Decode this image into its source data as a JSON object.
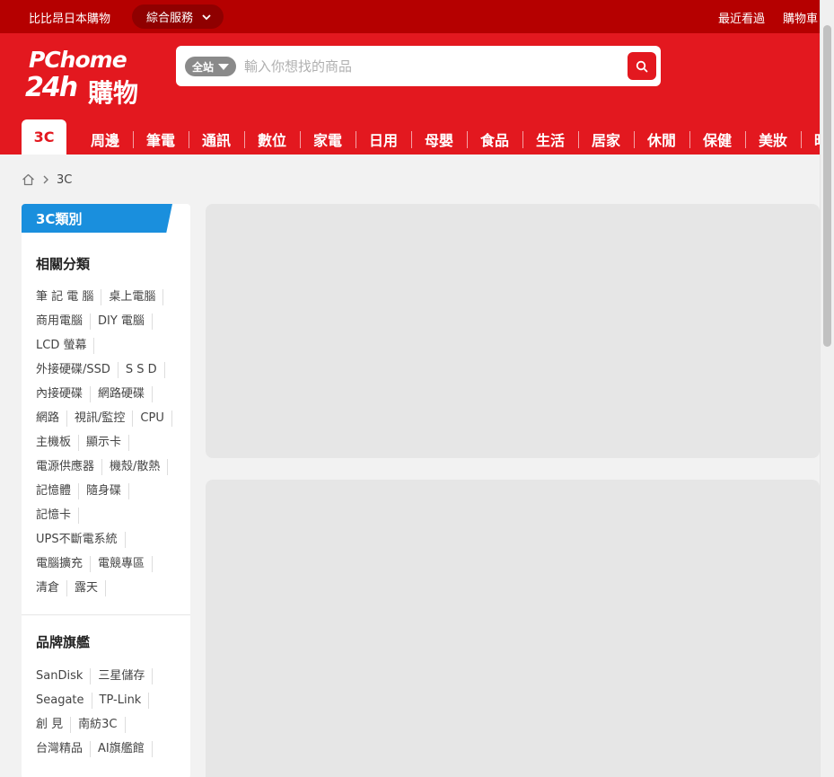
{
  "topbar": {
    "left_link": "比比昂日本購物",
    "service_label": "綜合服務",
    "recent": "最近看過",
    "cart": "購物車"
  },
  "logo": {
    "line1": "PChome",
    "line2": "24h",
    "line3": "購物"
  },
  "search": {
    "scope_label": "全站",
    "placeholder": "輸入你想找的商品"
  },
  "nav": {
    "tabs": [
      "3C",
      "周邊",
      "筆電",
      "通訊",
      "數位",
      "家電",
      "日用",
      "母嬰",
      "食品",
      "生活",
      "居家",
      "休閒",
      "保健",
      "美妝",
      "時尚"
    ]
  },
  "breadcrumb": {
    "current": "3C"
  },
  "sidebar": {
    "tag": "3C類別",
    "related_title": "相關分類",
    "related_rows": [
      [
        "筆 記 電 腦",
        "桌上電腦"
      ],
      [
        "商用電腦",
        "DIY 電腦"
      ],
      [
        "LCD 螢幕"
      ],
      [
        "外接硬碟/SSD",
        "S S D"
      ],
      [
        "內接硬碟",
        "網路硬碟"
      ],
      [
        "網路",
        "視訊/監控",
        "CPU"
      ],
      [
        "主機板",
        "顯示卡"
      ],
      [
        "電源供應器",
        "機殼/散熱"
      ],
      [
        "記憶體",
        "隨身碟"
      ],
      [
        "記憶卡"
      ],
      [
        "UPS不斷電系統"
      ],
      [
        "電腦擴充",
        "電競專區"
      ],
      [
        "清倉",
        "露天"
      ]
    ],
    "brand_title": "品牌旗艦",
    "brand_rows": [
      [
        "SanDisk",
        "三星儲存"
      ],
      [
        "Seagate",
        "TP-Link"
      ],
      [
        "創 見",
        "南紡3C"
      ],
      [
        "台灣精品",
        "AI旗艦館"
      ]
    ]
  }
}
